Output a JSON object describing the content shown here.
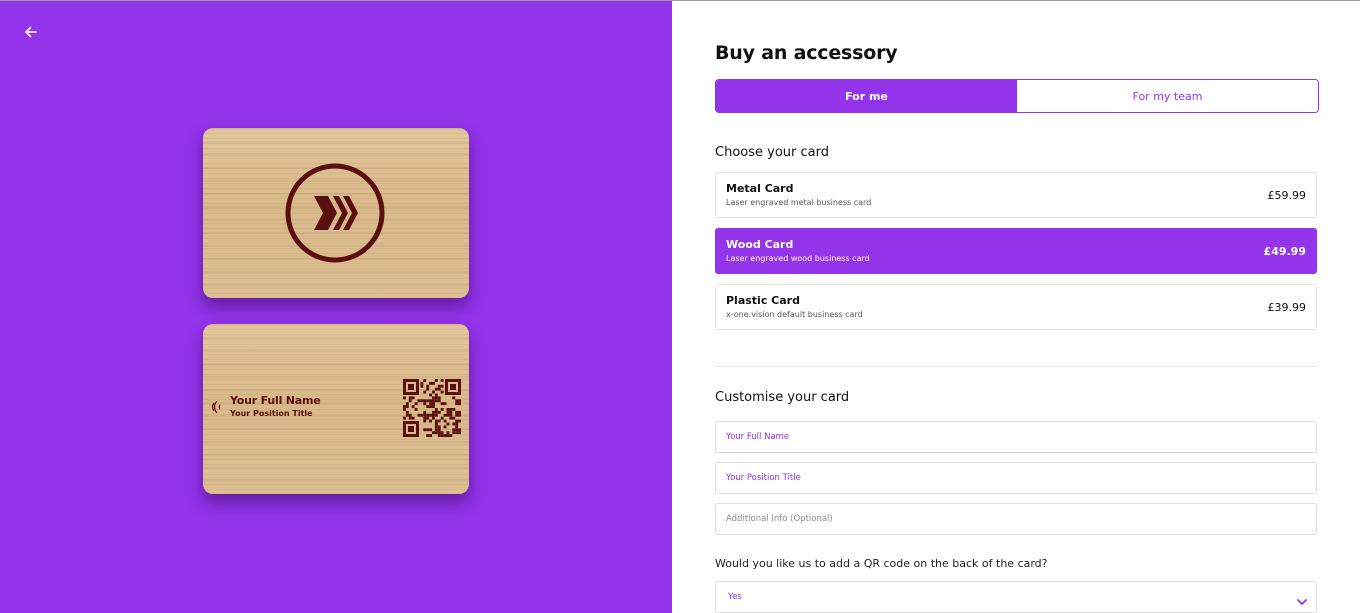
{
  "colors": {
    "accent": "#9333ea",
    "card_ink": "#5a1010"
  },
  "left_panel": {
    "back_icon": "arrow-left-icon"
  },
  "card_preview": {
    "name": "Your Full Name",
    "position": "Your Position Title",
    "logo_icon": "x-logo-icon",
    "nfc_icon": "nfc-wave-icon",
    "qr_icon": "qr-code-icon"
  },
  "page": {
    "title": "Buy an accessory",
    "tabs": [
      {
        "label": "For me",
        "active": true
      },
      {
        "label": "For my team",
        "active": false
      }
    ]
  },
  "choose": {
    "heading": "Choose your card",
    "options": [
      {
        "name": "Metal Card",
        "desc": "Laser engraved metal business card",
        "price": "£59.99",
        "selected": false
      },
      {
        "name": "Wood Card",
        "desc": "Laser engraved wood business card",
        "price": "£49.99",
        "selected": true
      },
      {
        "name": "Plastic Card",
        "desc": "x-one.vision default business card",
        "price": "£39.99",
        "selected": false
      }
    ]
  },
  "customise": {
    "heading": "Customise your card",
    "fields": {
      "full_name_placeholder": "Your Full Name",
      "position_placeholder": "Your Position Title",
      "info_placeholder": "Additional Info (Optional)"
    },
    "qr_question": "Would you like us to add a QR code on the back of the card?",
    "qr_select_value": "Yes",
    "qr_select_icon": "chevron-down-icon"
  }
}
